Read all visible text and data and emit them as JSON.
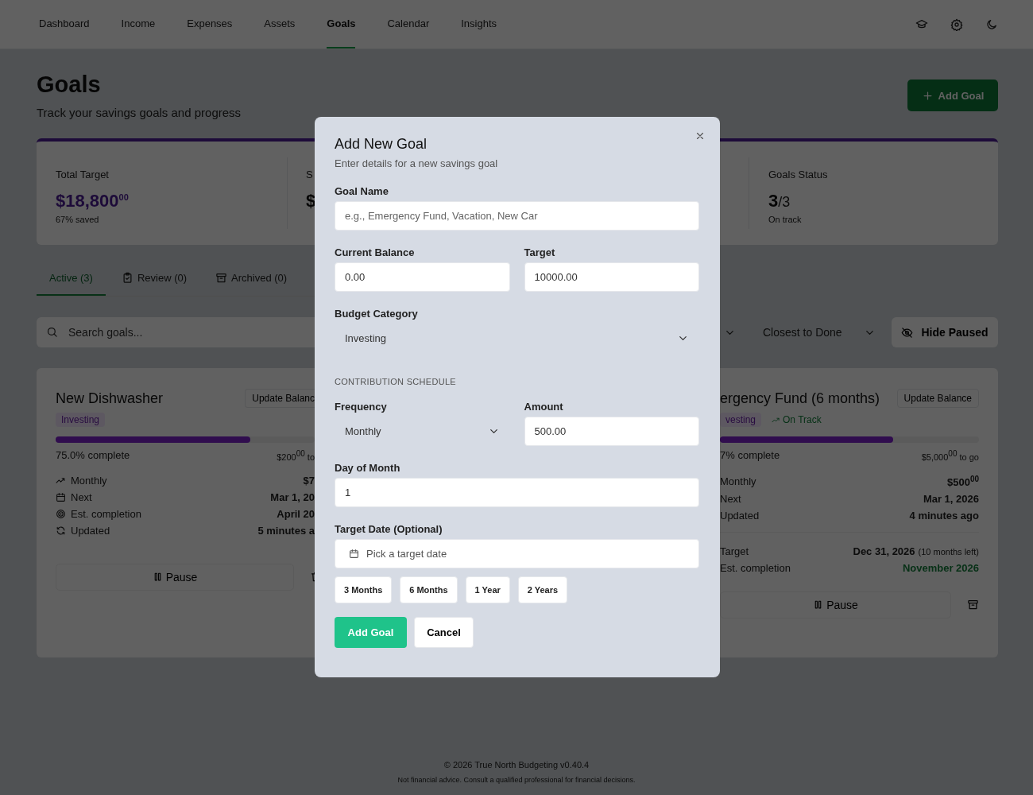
{
  "nav": {
    "items": [
      {
        "label": "Dashboard",
        "selected": false
      },
      {
        "label": "Income",
        "selected": false
      },
      {
        "label": "Expenses",
        "selected": false
      },
      {
        "label": "Assets",
        "selected": false
      },
      {
        "label": "Goals",
        "selected": true
      },
      {
        "label": "Calendar",
        "selected": false
      },
      {
        "label": "Insights",
        "selected": false
      }
    ]
  },
  "header": {
    "title": "Goals",
    "subtitle": "Track your savings goals and progress",
    "add_button": "Add Goal"
  },
  "stats": [
    {
      "kind": "full",
      "label": "Total Target",
      "value": "$18,800$^{00}$",
      "note": "67% saved"
    },
    {
      "kind": "partial",
      "label": "S",
      "value": "$"
    },
    {
      "kind": "status",
      "label": "Goals Status",
      "value": "3",
      "suffix": "/3",
      "note": "On track"
    }
  ],
  "tabs": [
    {
      "label": "Active (3)",
      "selected": true
    },
    {
      "label": "Review (0)",
      "selected": false
    },
    {
      "label": "Archived (0)",
      "selected": false
    }
  ],
  "filters": {
    "search_placeholder": "Search goals...",
    "sort": "Closest to Done",
    "hide_paused": "Hide Paused"
  },
  "goals": [
    {
      "title": "New Dishwasher",
      "update_label": "Update Balanc",
      "tags": [
        {
          "kind": "category",
          "label": "Investing"
        }
      ],
      "level": 0.75,
      "complete": "75.0% complete",
      "remaining": "$200$^{00}$ to",
      "details": [
        {
          "label": "Monthly",
          "value": "$7"
        },
        {
          "label": "Next",
          "value": "Mar 1, 20"
        },
        {
          "label": "Est. completion",
          "value": "April 20"
        },
        {
          "label": "Updated",
          "value": "5 minutes a"
        }
      ],
      "pause_label": "Pause"
    },
    {
      "title": "ergency Fund (6 months)",
      "update_label": "Update Balance",
      "tags": [
        {
          "kind": "category",
          "label": "vesting"
        },
        {
          "kind": "status",
          "label": "On Track"
        }
      ],
      "level": 0.67,
      "complete": "7% complete",
      "remaining": "$5,000$^{00}$ to go",
      "details": [
        {
          "label": "Monthly",
          "value": "$500$^{00}$"
        },
        {
          "label": "Next",
          "value": "Mar 1, 2026"
        },
        {
          "label": "Updated",
          "value": "4 minutes ago"
        }
      ],
      "details_2": [
        {
          "kind": "plain",
          "label": "Target",
          "value": "Dec 31, 2026",
          "note": "(10 months left)"
        },
        {
          "kind": "highlight",
          "label": "Est. completion",
          "value": "November 2026"
        }
      ],
      "pause_label": "Pause"
    }
  ],
  "modal": {
    "title": "Add New Goal",
    "subtitle": "Enter details for a new savings goal",
    "goal_name": {
      "label": "Goal Name",
      "placeholder": "e.g., Emergency Fund, Vacation, New Car"
    },
    "current_balance": {
      "label": "Current Balance",
      "value": "0.00"
    },
    "target": {
      "label": "Target",
      "value": "10000.00"
    },
    "budget_category": {
      "label": "Budget Category",
      "value": "Investing"
    },
    "section_label": "CONTRIBUTION SCHEDULE",
    "frequency": {
      "label": "Frequency",
      "value": "Monthly"
    },
    "amount": {
      "label": "Amount",
      "value": "500.00"
    },
    "day_of_month": {
      "label": "Day of Month",
      "value": "1"
    },
    "target_date": {
      "label": "Target Date (Optional)",
      "placeholder": "Pick a target date"
    },
    "presets": [
      "3 Months",
      "6 Months",
      "1 Year",
      "2 Years"
    ],
    "submit": "Add Goal",
    "cancel": "Cancel"
  },
  "footer": {
    "copyright": "© 2026 True North Budgeting v0.40.4",
    "disclaimer": "Not financial advice. Consult a qualified professional for financial decisions."
  }
}
